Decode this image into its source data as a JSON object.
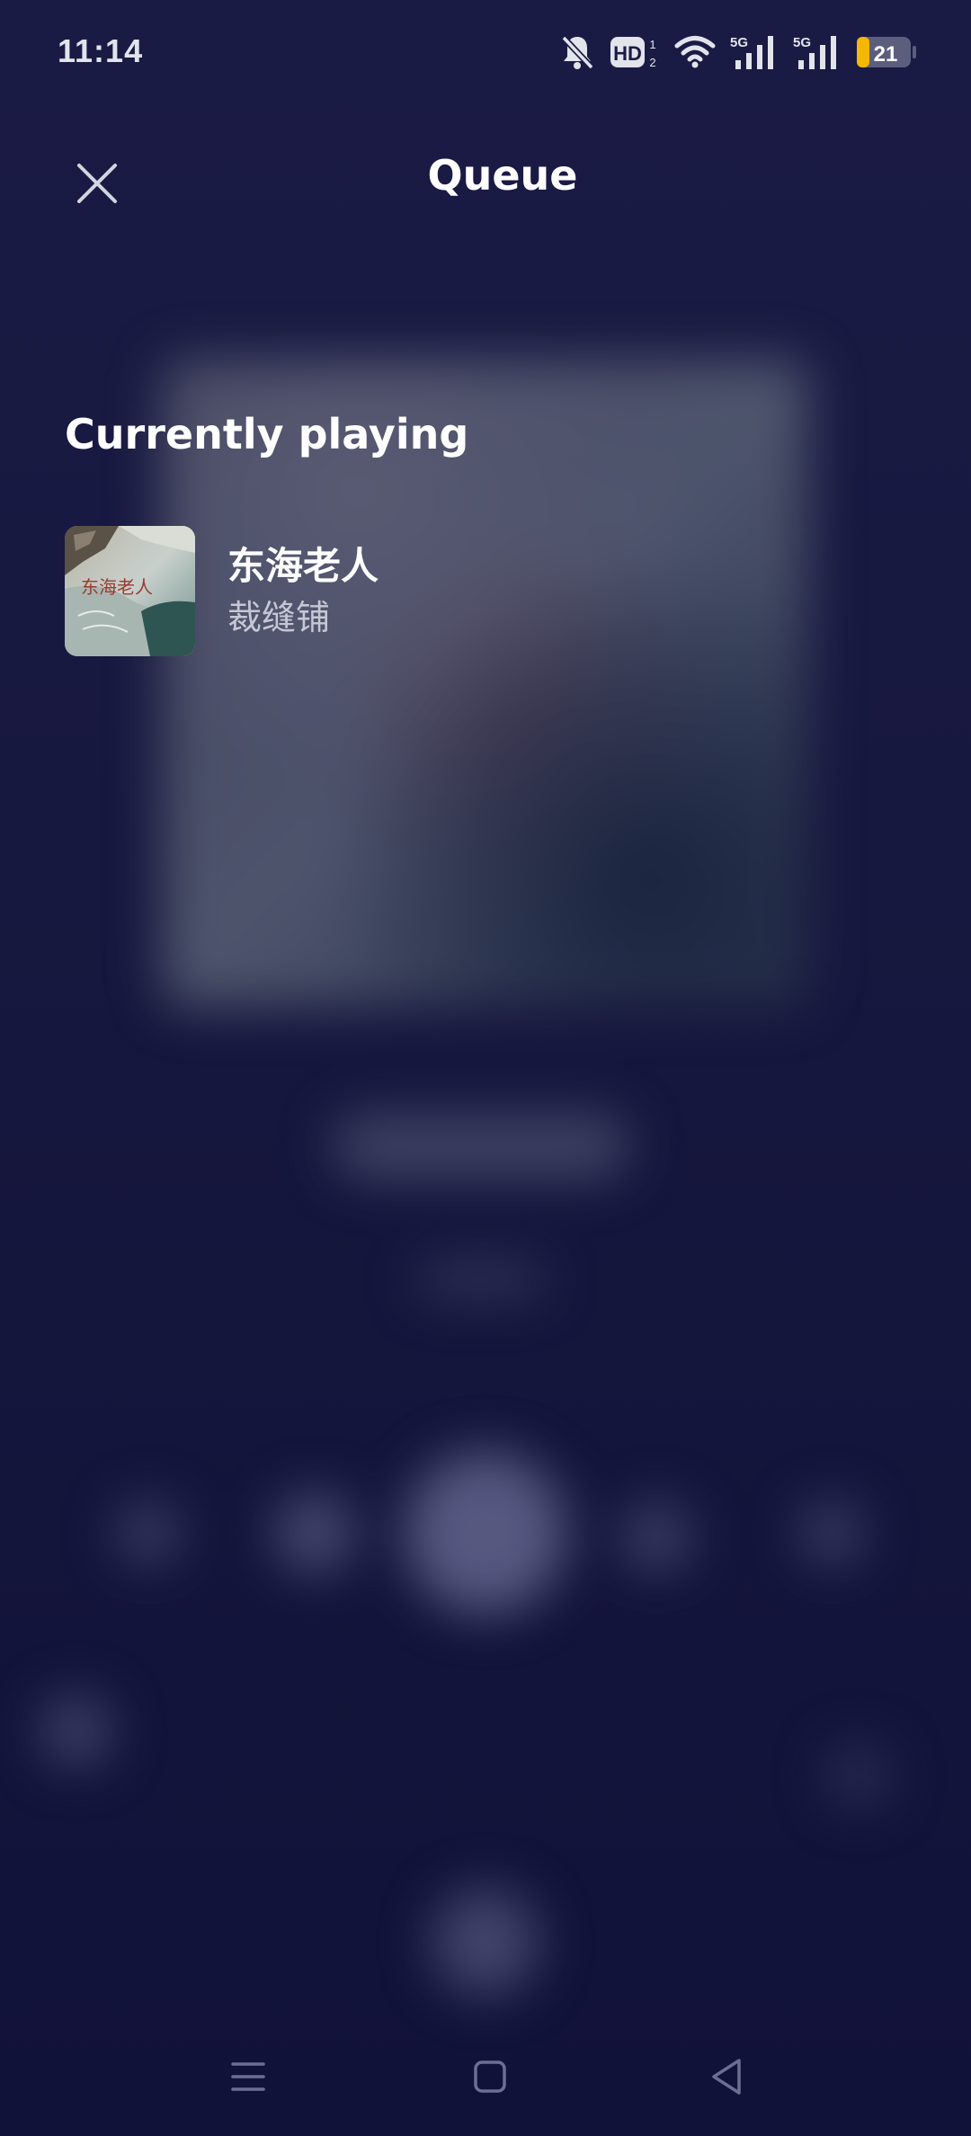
{
  "status_bar": {
    "time": "11:14",
    "hd_label": "HD",
    "hd_sub": "1\n2",
    "network_1": "5G",
    "network_2": "5G",
    "battery": "21"
  },
  "header": {
    "title": "Queue",
    "close_icon": "close-icon"
  },
  "queue": {
    "section_title": "Currently playing",
    "current_track": {
      "title": "东海老人",
      "artist": "裁缝铺",
      "art_text": "东海老人"
    }
  },
  "nav_bar": {
    "icons": [
      "menu-icon",
      "home-square-icon",
      "back-triangle-icon"
    ]
  },
  "colors": {
    "background": "#17183f",
    "text_primary": "#ffffff",
    "text_secondary": "#c6c7d6",
    "battery_accent": "#f5b700"
  }
}
